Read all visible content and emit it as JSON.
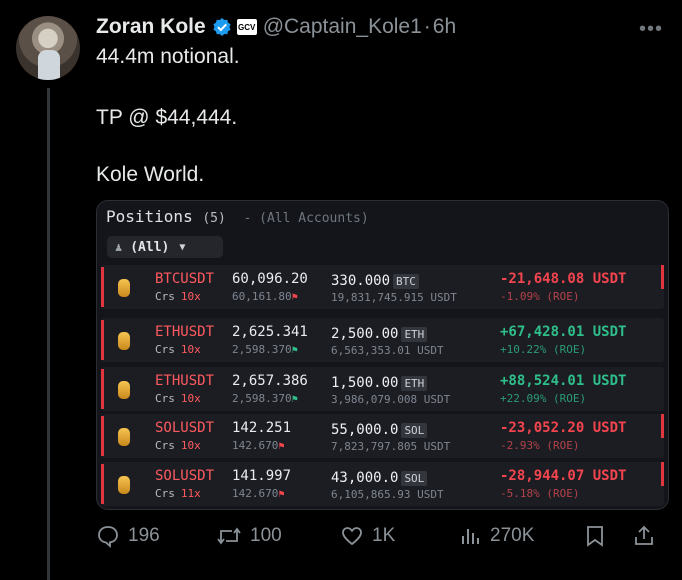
{
  "author": {
    "name": "Zoran Kole",
    "affiliate_badge": "GCV",
    "handle": "@Captain_Kole1",
    "separator": "·",
    "time": "6h"
  },
  "tweet": {
    "line1": "44.4m notional.",
    "line2": "TP @ $44,444.",
    "line3": "Kole World."
  },
  "card": {
    "title": "Positions",
    "count": "(5)",
    "accounts": "- (All Accounts)",
    "filter_label": "(All)",
    "rows": [
      {
        "symbol": "BTCUSDT",
        "mode": "Crs",
        "leverage": "10x",
        "entry": "60,096.20",
        "mark": "60,161.80",
        "qty": "330.000",
        "unit": "BTC",
        "notional": "19,831,745.915 USDT",
        "pnl": "-21,648.08 USDT",
        "roe": "-1.09% (ROE)",
        "dir": "neg"
      },
      {
        "symbol": "ETHUSDT",
        "mode": "Crs",
        "leverage": "10x",
        "entry": "2,625.341",
        "mark": "2,598.370",
        "qty": "2,500.00",
        "unit": "ETH",
        "notional": "6,563,353.01 USDT",
        "pnl": "+67,428.01 USDT",
        "roe": "+10.22% (ROE)",
        "dir": "pos"
      },
      {
        "symbol": "ETHUSDT",
        "mode": "Crs",
        "leverage": "10x",
        "entry": "2,657.386",
        "mark": "2,598.370",
        "qty": "1,500.00",
        "unit": "ETH",
        "notional": "3,986,079.008 USDT",
        "pnl": "+88,524.01 USDT",
        "roe": "+22.09% (ROE)",
        "dir": "pos"
      },
      {
        "symbol": "SOLUSDT",
        "mode": "Crs",
        "leverage": "10x",
        "entry": "142.251",
        "mark": "142.670",
        "qty": "55,000.0",
        "unit": "SOL",
        "notional": "7,823,797.805 USDT",
        "pnl": "-23,052.20 USDT",
        "roe": "-2.93% (ROE)",
        "dir": "neg"
      },
      {
        "symbol": "SOLUSDT",
        "mode": "Crs",
        "leverage": "11x",
        "entry": "141.997",
        "mark": "142.670",
        "qty": "43,000.0",
        "unit": "SOL",
        "notional": "6,105,865.93 USDT",
        "pnl": "-28,944.07 USDT",
        "roe": "-5.18% (ROE)",
        "dir": "neg"
      }
    ]
  },
  "actions": {
    "replies": "196",
    "reposts": "100",
    "likes": "1K",
    "views": "270K"
  },
  "colors": {
    "accent_blue": "#1d9bf0",
    "loss": "#f4454e",
    "profit": "#2fbf8a"
  }
}
